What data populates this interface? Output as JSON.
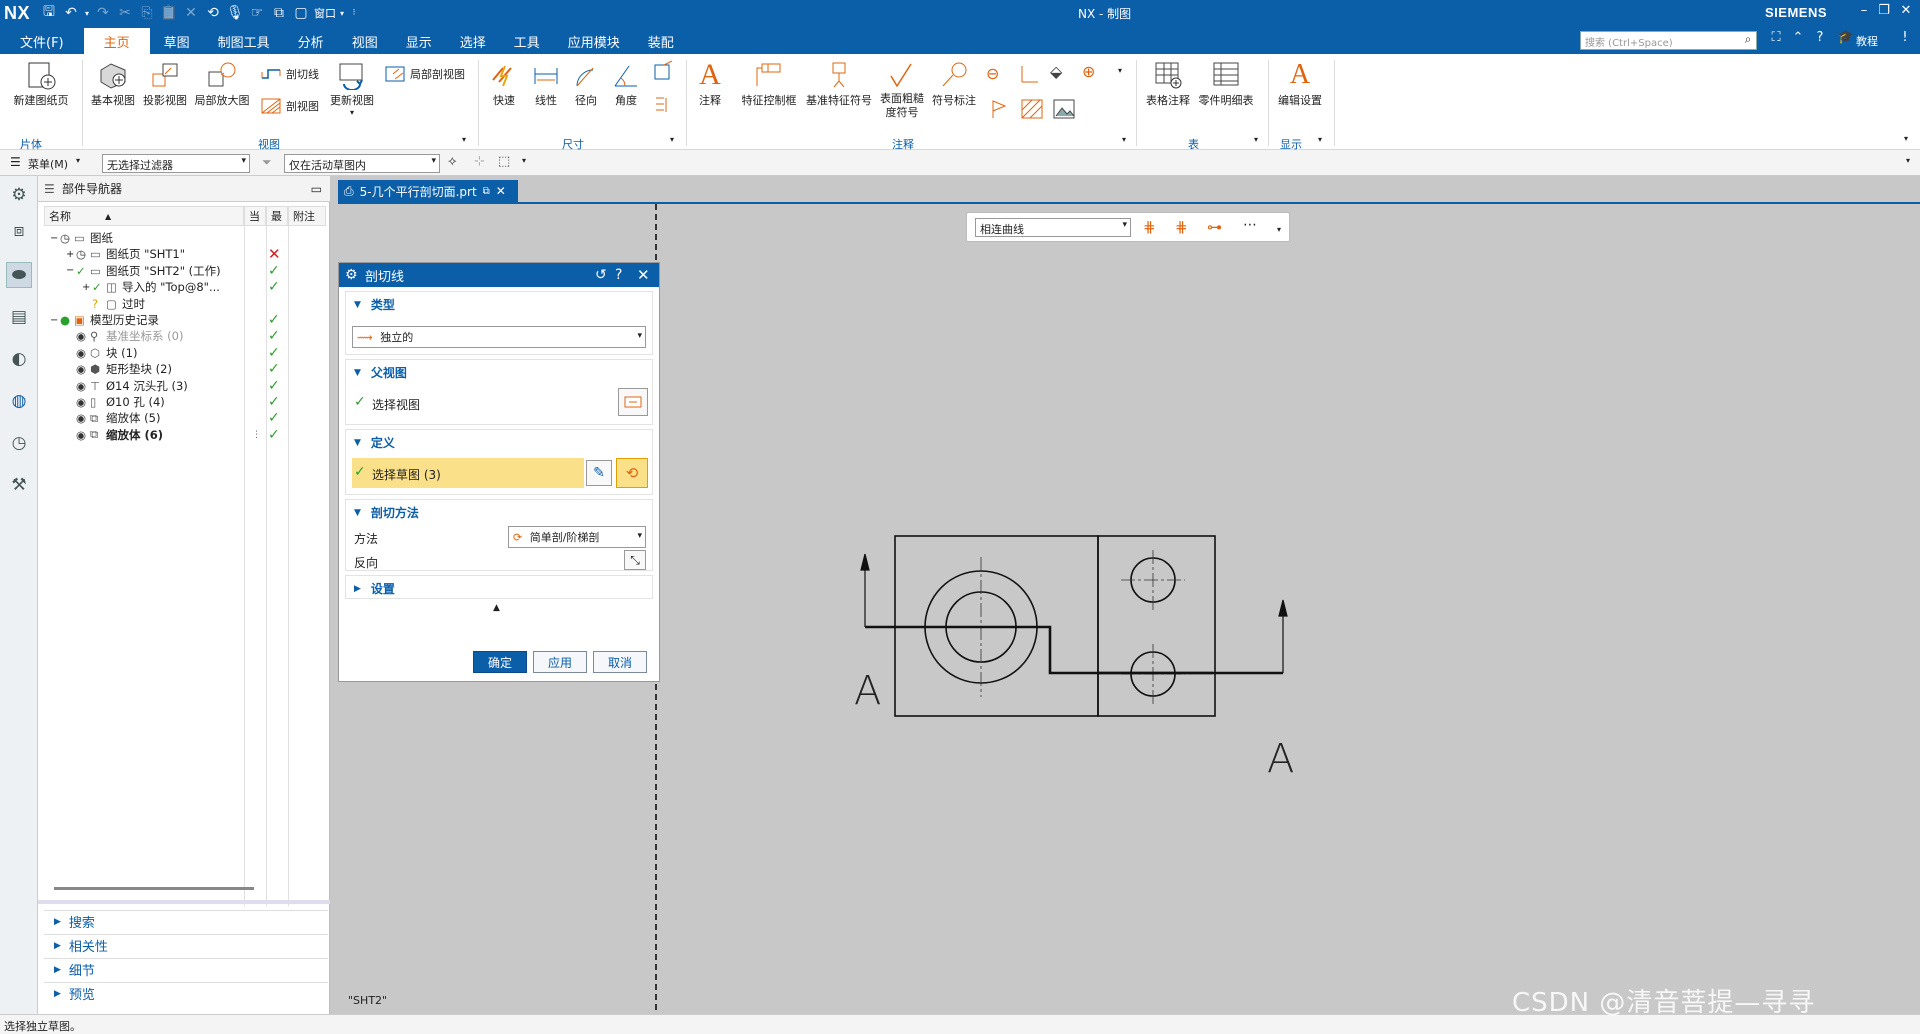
{
  "app": {
    "logo": "NX",
    "title": "NX - 制图",
    "brand": "SIEMENS",
    "tutorial": "教程",
    "window_menu": "窗口"
  },
  "menu": {
    "tabs": [
      "文件(F)",
      "主页",
      "草图",
      "制图工具",
      "分析",
      "视图",
      "显示",
      "选择",
      "工具",
      "应用模块",
      "装配"
    ],
    "active": "主页",
    "search_placeholder": "搜索 (Ctrl+Space)"
  },
  "ribbon": {
    "groups": {
      "sheet": "片体",
      "view": "视图",
      "dimension": "尺寸",
      "annotation": "注释",
      "table": "表",
      "display": "显示"
    },
    "buttons": {
      "new_sheet": "新建图纸页",
      "base_view": "基本视图",
      "projected_view": "投影视图",
      "detail_view": "局部放大图",
      "section_line": "剖切线",
      "section_view": "剖视图",
      "update_view": "更新视图",
      "break_out_section": "局部剖视图",
      "rapid": "快速",
      "linear": "线性",
      "radial": "径向",
      "angular": "角度",
      "note": "注释",
      "fcf": "特征控制框",
      "datum_symbol": "基准特征符号",
      "surface_finish": "表面粗糙度符号",
      "symbol_label": "符号标注",
      "tabular_note": "表格注释",
      "parts_list": "零件明细表",
      "edit_settings": "编辑设置"
    }
  },
  "filterbar": {
    "menu_label": "菜单(M)",
    "filter_value": "无选择过滤器",
    "scope_value": "仅在活动草图内"
  },
  "navigator": {
    "title": "部件导航器",
    "columns": [
      "名称",
      "当",
      "最",
      "附注"
    ],
    "rows": [
      {
        "label": "图纸",
        "status": ""
      },
      {
        "label": "图纸页 \"SHT1\"",
        "status": "x"
      },
      {
        "label": "图纸页 \"SHT2\" (工作)",
        "status": "check"
      },
      {
        "label": "导入的 \"Top@8\"...",
        "status": "check"
      },
      {
        "label": "过时",
        "status": ""
      },
      {
        "label": "模型历史记录",
        "status": "check"
      },
      {
        "label": "基准坐标系 (0)",
        "status": "check"
      },
      {
        "label": "块 (1)",
        "status": "check"
      },
      {
        "label": "矩形垫块 (2)",
        "status": "check"
      },
      {
        "label": "Ø14 沉头孔 (3)",
        "status": "check"
      },
      {
        "label": "Ø10 孔 (4)",
        "status": "check"
      },
      {
        "label": "缩放体 (5)",
        "status": "check"
      },
      {
        "label": "缩放体 (6)",
        "status": "check"
      }
    ],
    "panels": [
      "搜索",
      "相关性",
      "细节",
      "预览"
    ]
  },
  "document": {
    "tab": "5-几个平行剖切面.prt",
    "sheet_label": "\"SHT2\""
  },
  "curve_toolbar": {
    "rule": "相连曲线"
  },
  "dialog": {
    "title": "剖切线",
    "sections": {
      "type": "类型",
      "parent_view": "父视图",
      "define": "定义",
      "method": "剖切方法",
      "settings": "设置"
    },
    "type_value": "独立的",
    "select_view": "选择视图",
    "select_sketch": "选择草图 (3)",
    "method_label": "方法",
    "method_value": "简单剖/阶梯剖",
    "reverse_label": "反向",
    "ok": "确定",
    "apply": "应用",
    "cancel": "取消"
  },
  "drawing": {
    "label_left": "A",
    "label_right": "A"
  },
  "status": {
    "message": "选择独立草图。"
  },
  "watermark": "CSDN @清音菩提—寻寻"
}
